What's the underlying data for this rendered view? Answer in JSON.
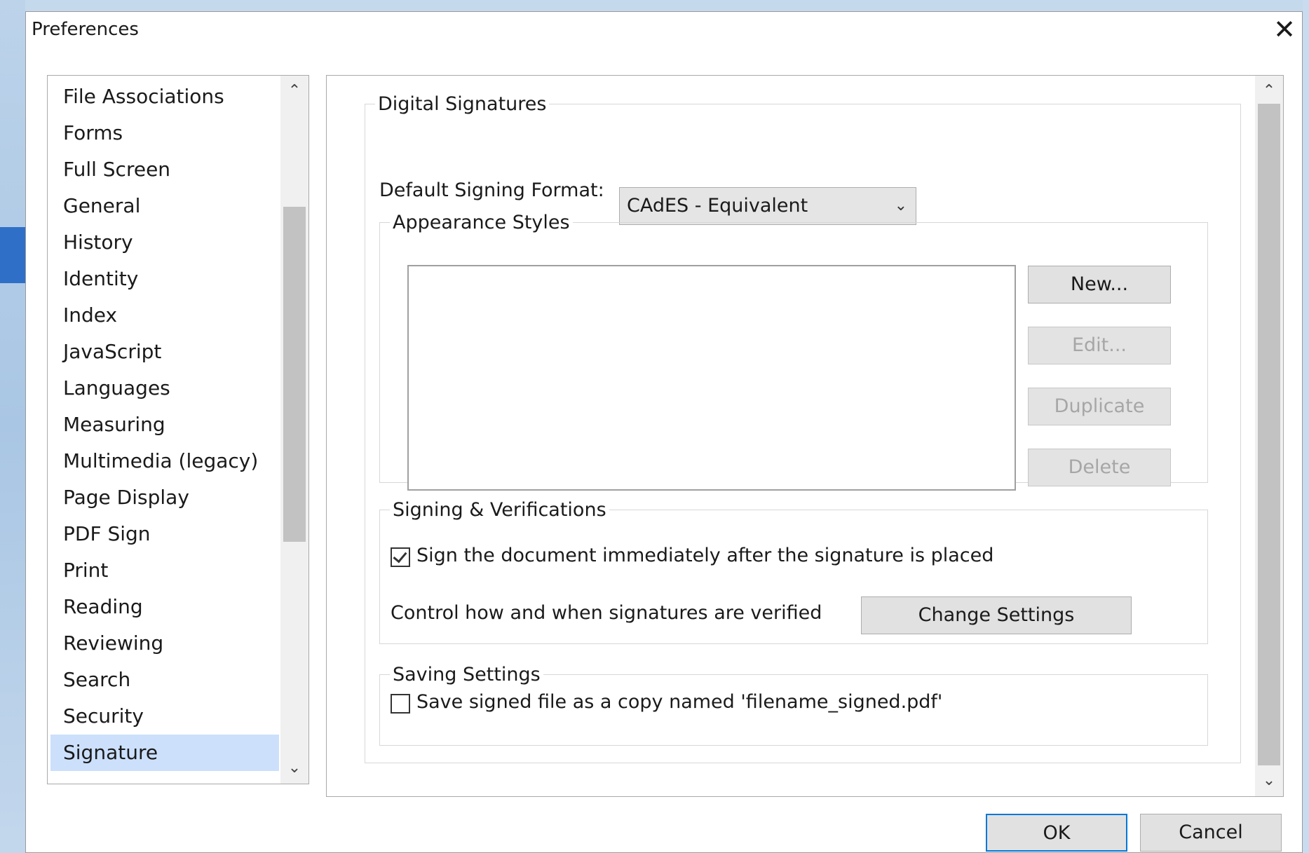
{
  "dialog": {
    "title": "Preferences",
    "close_icon": "close-icon",
    "ok_label": "OK",
    "cancel_label": "Cancel"
  },
  "categories": [
    {
      "label": "File Associations"
    },
    {
      "label": "Forms"
    },
    {
      "label": "Full Screen"
    },
    {
      "label": "General"
    },
    {
      "label": "History"
    },
    {
      "label": "Identity"
    },
    {
      "label": "Index"
    },
    {
      "label": "JavaScript"
    },
    {
      "label": "Languages"
    },
    {
      "label": "Measuring"
    },
    {
      "label": "Multimedia (legacy)"
    },
    {
      "label": "Page Display"
    },
    {
      "label": "PDF Sign"
    },
    {
      "label": "Print"
    },
    {
      "label": "Reading"
    },
    {
      "label": "Reviewing"
    },
    {
      "label": "Search"
    },
    {
      "label": "Security"
    },
    {
      "label": "Signature"
    }
  ],
  "selected_category": "Signature",
  "digital_signatures": {
    "group_label": "Digital Signatures",
    "format_label": "Default Signing Format:",
    "format_value": "CAdES - Equivalent",
    "appearance": {
      "group_label": "Appearance Styles",
      "buttons": {
        "new": "New...",
        "edit": "Edit...",
        "duplicate": "Duplicate",
        "delete": "Delete"
      }
    },
    "signing": {
      "group_label": "Signing & Verifications",
      "sign_immediately_label": "Sign the document immediately after the signature is placed",
      "sign_immediately_checked": true,
      "verify_label": "Control how and when signatures are verified",
      "change_settings_label": "Change Settings"
    },
    "saving": {
      "group_label": "Saving Settings",
      "save_copy_label": "Save signed file as a copy named 'filename_signed.pdf'",
      "save_copy_checked": false
    }
  },
  "icons": {
    "scroll_up": "chevron-up-icon",
    "scroll_down": "chevron-down-icon",
    "dropdown": "chevron-down-icon",
    "checkmark": "checkmark-icon"
  },
  "colors": {
    "selection": "#cce0fc",
    "default_button_border": "#0078d7",
    "desktop": "#c5d9ec"
  }
}
